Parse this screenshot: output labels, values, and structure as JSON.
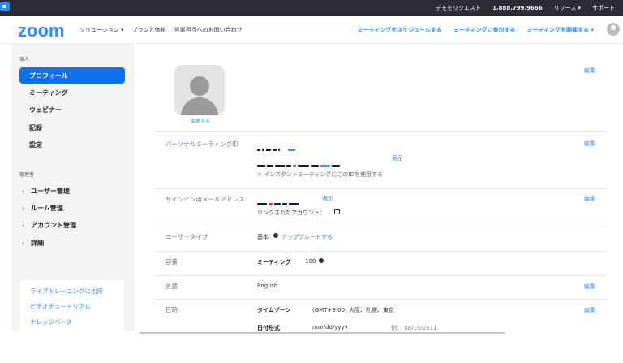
{
  "topbar": {
    "links": [
      {
        "label": "デモをリクエスト"
      },
      {
        "label": "1.888.799.9666"
      },
      {
        "label": "リソース ▾"
      },
      {
        "label": "サポート"
      }
    ]
  },
  "header": {
    "logo": "zoom",
    "nav_left": [
      "ソリューション ▾",
      "プランと価格",
      "営業担当へのお問い合わせ"
    ],
    "nav_right": [
      "ミーティングをスケジュールする",
      "ミーティングに参加する",
      "ミーティングを開催する ▾"
    ]
  },
  "sidebar": {
    "section_personal": "個人",
    "personal_items": [
      "プロフィール",
      "ミーティング",
      "ウェビナー",
      "記録",
      "設定"
    ],
    "active_index": 0,
    "section_admin": "管理者",
    "admin_items": [
      "ユーザー管理",
      "ルーム管理",
      "アカウント管理",
      "詳細"
    ],
    "bottom_links": [
      "ライブトレーニングに出席",
      "ビデオチュートリアル",
      "ナレッジベース"
    ]
  },
  "profile": {
    "edit_label": "編集",
    "change_link": "変更する",
    "pmi": {
      "label": "パーソナルミーティングID",
      "show_link": "表示",
      "instant_note": "× インスタントミーティングにこのIDを使用する"
    },
    "signin_email": {
      "label": "サインイン用メールアドレス",
      "show_link": "表示",
      "linked_accounts": "リンクされたアカウント："
    },
    "user_type": {
      "label": "ユーザータイプ",
      "value": "基本",
      "upgrade_link": "アップグレードする"
    },
    "capacity": {
      "label": "容量",
      "meeting_label": "ミーティング",
      "meeting_value": "100"
    },
    "language": {
      "label": "言語",
      "value": "English"
    },
    "datetime": {
      "label": "日時",
      "timezone_label": "タイムゾーン",
      "timezone_value": "(GMT+9:00) 大阪、札幌、東京",
      "date_format_label": "日付形式",
      "date_format_value": "mm/dd/yyyy",
      "date_example": "例： 08/15/2011"
    }
  },
  "colors": {
    "brand": "#2d8cff",
    "active_nav": "#0e72ed",
    "topbar": "#2c2c38"
  },
  "icons": [
    "zoom-app-icon",
    "avatar-icon",
    "profile-placeholder-icon",
    "help-circle-icon",
    "linked-account-icon"
  ]
}
